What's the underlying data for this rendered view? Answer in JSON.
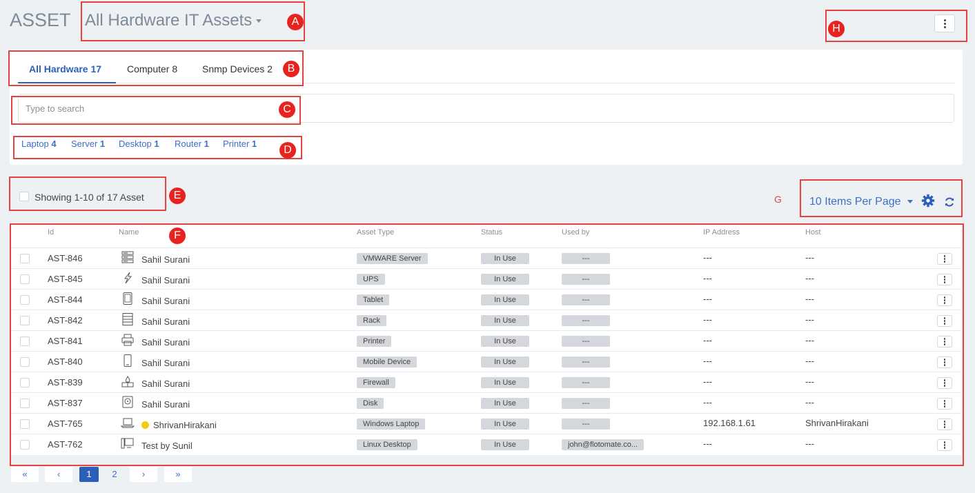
{
  "header": {
    "module_title": "ASSET",
    "view_title": "All Hardware IT Assets"
  },
  "markers": {
    "a": "A",
    "b": "B",
    "c": "C",
    "d": "D",
    "e": "E",
    "f": "F",
    "g": "G",
    "h": "H"
  },
  "tabs": [
    {
      "label": "All Hardware 17",
      "active": true
    },
    {
      "label": "Computer 8",
      "active": false
    },
    {
      "label": "Snmp Devices 2",
      "active": false
    }
  ],
  "search": {
    "placeholder": "Type to search",
    "value": ""
  },
  "type_filters": [
    {
      "label": "Laptop",
      "count": "4"
    },
    {
      "label": "Server",
      "count": "1"
    },
    {
      "label": "Desktop",
      "count": "1"
    },
    {
      "label": "Router",
      "count": "1"
    },
    {
      "label": "Printer",
      "count": "1"
    }
  ],
  "list_controls": {
    "showing": "Showing 1-10 of 17 Asset",
    "items_per_page": "10 Items Per Page"
  },
  "table": {
    "columns": [
      "Id",
      "Name",
      "Asset Type",
      "Status",
      "Used by",
      "IP Address",
      "Host"
    ],
    "rows": [
      {
        "id": "AST-846",
        "icon": "server-rack-icon",
        "name": "Sahil Surani",
        "type": "VMWARE Server",
        "status": "In Use",
        "used_by": "---",
        "ip": "---",
        "host": "---"
      },
      {
        "id": "AST-845",
        "icon": "ups-bolt-icon",
        "name": "Sahil Surani",
        "type": "UPS",
        "status": "In Use",
        "used_by": "---",
        "ip": "---",
        "host": "---"
      },
      {
        "id": "AST-844",
        "icon": "tablet-icon",
        "name": "Sahil Surani",
        "type": "Tablet",
        "status": "In Use",
        "used_by": "---",
        "ip": "---",
        "host": "---"
      },
      {
        "id": "AST-842",
        "icon": "rack-icon",
        "name": "Sahil Surani",
        "type": "Rack",
        "status": "In Use",
        "used_by": "---",
        "ip": "---",
        "host": "---"
      },
      {
        "id": "AST-841",
        "icon": "printer-icon",
        "name": "Sahil Surani",
        "type": "Printer",
        "status": "In Use",
        "used_by": "---",
        "ip": "---",
        "host": "---"
      },
      {
        "id": "AST-840",
        "icon": "mobile-device-icon",
        "name": "Sahil Surani",
        "type": "Mobile Device",
        "status": "In Use",
        "used_by": "---",
        "ip": "---",
        "host": "---"
      },
      {
        "id": "AST-839",
        "icon": "firewall-icon",
        "name": "Sahil Surani",
        "type": "Firewall",
        "status": "In Use",
        "used_by": "---",
        "ip": "---",
        "host": "---"
      },
      {
        "id": "AST-837",
        "icon": "disk-icon",
        "name": "Sahil Surani",
        "type": "Disk",
        "status": "In Use",
        "used_by": "---",
        "ip": "---",
        "host": "---"
      },
      {
        "id": "AST-765",
        "icon": "laptop-icon",
        "name": "ShrivanHirakani",
        "type": "Windows Laptop",
        "status": "In Use",
        "used_by": "---",
        "ip": "192.168.1.61",
        "host": "ShrivanHirakani"
      },
      {
        "id": "AST-762",
        "icon": "desktop-icon",
        "name": "Test by Sunil",
        "type": "Linux Desktop",
        "status": "In Use",
        "used_by": "john@flotomate.co...",
        "ip": "---",
        "host": "---"
      }
    ]
  },
  "pagination": {
    "first": "«",
    "prev": "‹",
    "pages": [
      "1",
      "2"
    ],
    "current": "1",
    "next": "›",
    "last": "»"
  },
  "colors": {
    "accent": "#2c5fb8",
    "link": "#3b6fc8",
    "annotation": "#e8423f",
    "online_dot": "#f3cc12"
  }
}
